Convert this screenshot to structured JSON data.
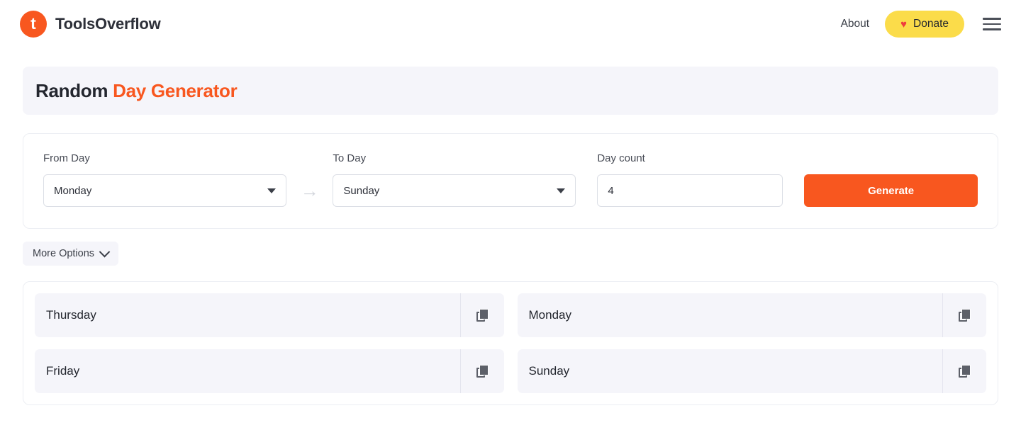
{
  "header": {
    "brand_initial": "t",
    "brand_name": "ToolsOverflow",
    "about_label": "About",
    "donate_label": "Donate",
    "heart_glyph": "♥"
  },
  "title": {
    "plain": "Random",
    "accent": "Day Generator"
  },
  "form": {
    "from_day": {
      "label": "From Day",
      "value": "Monday"
    },
    "arrow_glyph": "→",
    "to_day": {
      "label": "To Day",
      "value": "Sunday"
    },
    "day_count": {
      "label": "Day count",
      "value": "4",
      "placeholder": "Day count"
    },
    "generate_label": "Generate"
  },
  "more_options_label": "More Options",
  "results": [
    {
      "day": "Thursday"
    },
    {
      "day": "Monday"
    },
    {
      "day": "Friday"
    },
    {
      "day": "Sunday"
    }
  ],
  "colors": {
    "accent": "#f8571f",
    "donate_bg": "#fbdc4a",
    "heart": "#ef3d3d",
    "panel_bg": "#f5f5fa"
  }
}
